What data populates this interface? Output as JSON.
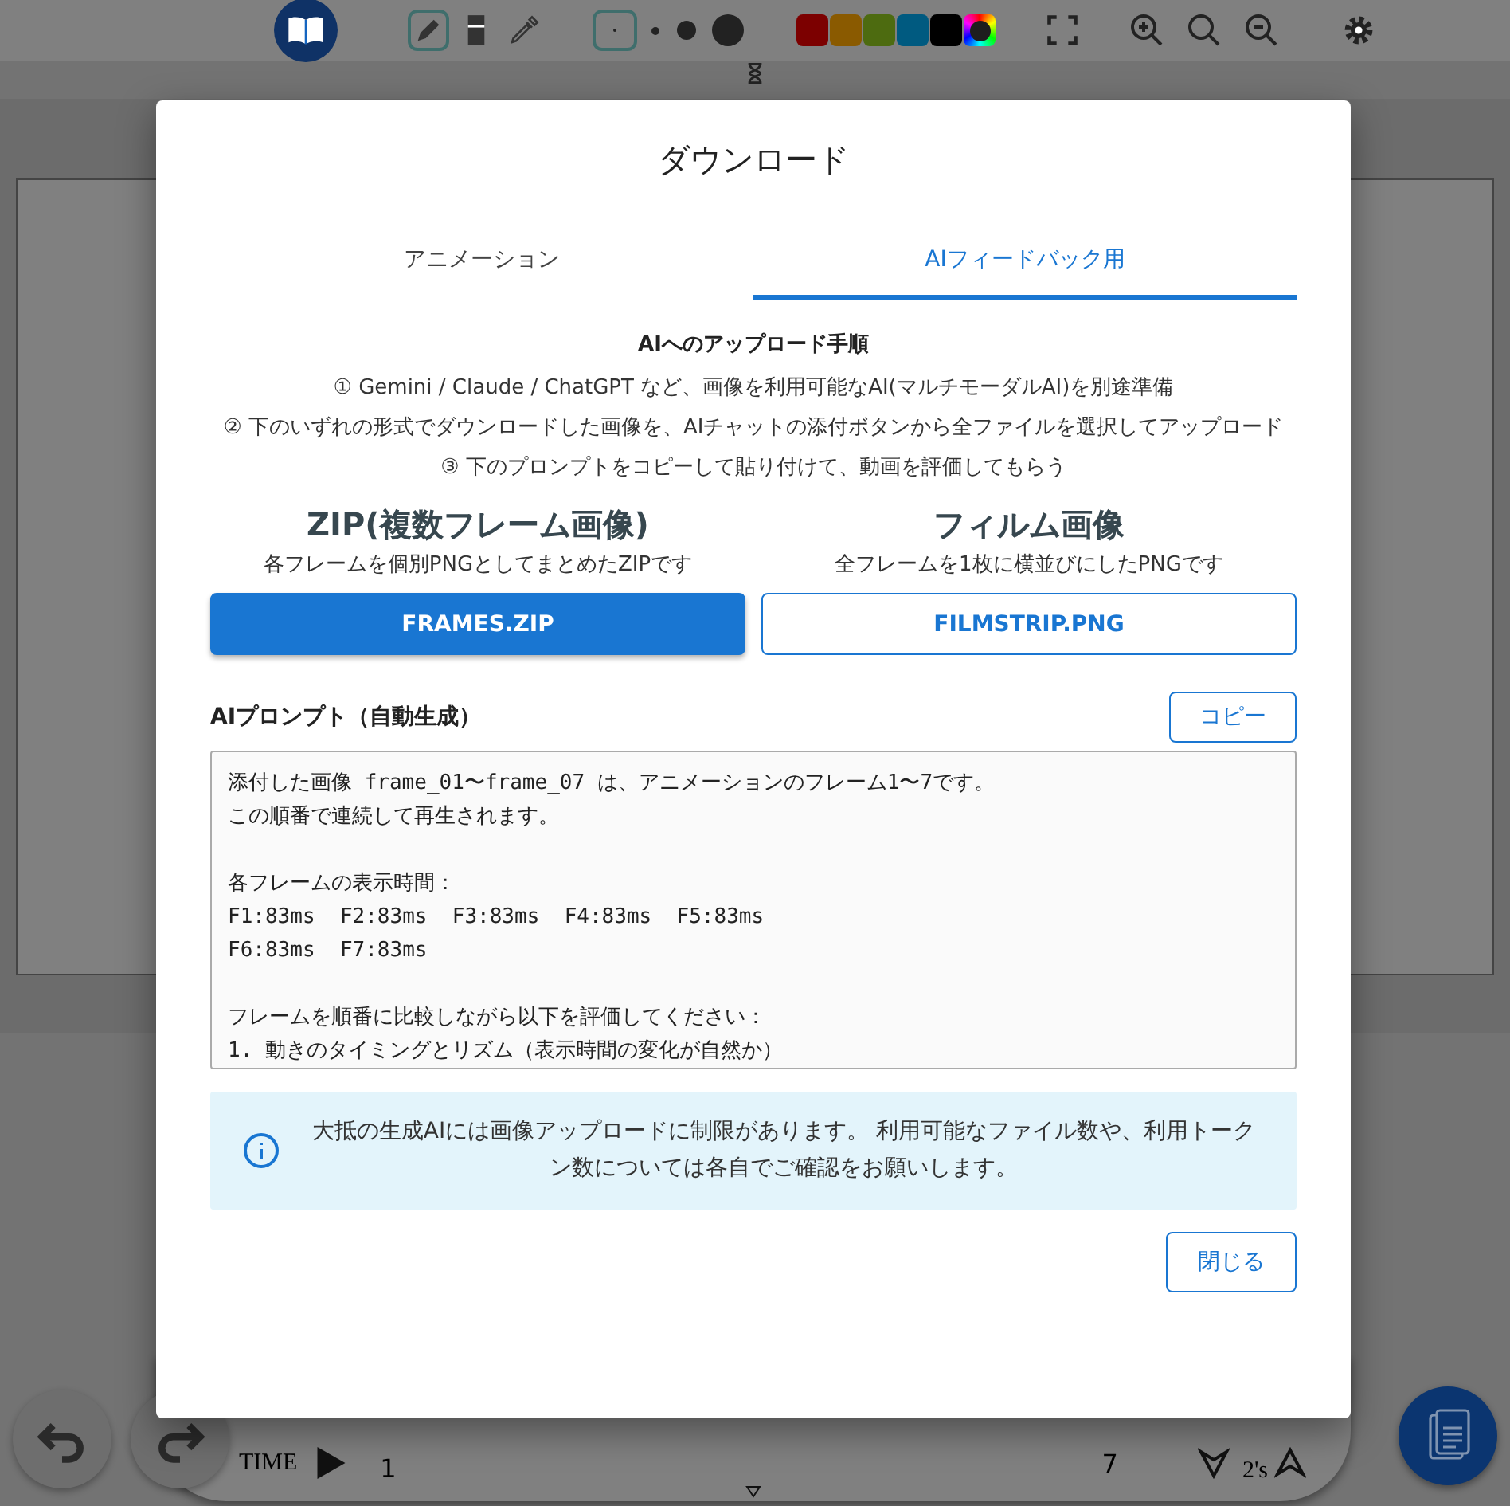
{
  "toolbar": {
    "tools": [
      {
        "kind": "pen",
        "selected": true
      },
      {
        "kind": "eraser",
        "selected": false
      },
      {
        "kind": "dropper",
        "selected": false
      }
    ],
    "brush_sizes": [
      {
        "selected": true
      },
      {
        "selected": false
      },
      {
        "selected": false
      },
      {
        "selected": false
      }
    ],
    "colors": [
      {
        "kind": "swatch",
        "color": "#7c0000"
      },
      {
        "kind": "swatch",
        "color": "#8a5a00"
      },
      {
        "kind": "swatch",
        "color": "#4d6b10"
      },
      {
        "kind": "swatch",
        "color": "#005a80"
      },
      {
        "kind": "swatch",
        "color": "#000000"
      },
      {
        "kind": "picker"
      }
    ]
  },
  "timeline": {
    "label": "TIME",
    "start": "1",
    "end": "7",
    "speed": "2's"
  },
  "dialog": {
    "title": "ダウンロード",
    "tabs": [
      {
        "label": "アニメーション",
        "selected": false
      },
      {
        "label": "AIフィードバック用",
        "selected": true
      }
    ],
    "instructions": {
      "heading": "AIへのアップロード手順",
      "steps": [
        "① Gemini / Claude / ChatGPT など、画像を利用可能なAI(マルチモーダルAI)を別途準備",
        "② 下のいずれの形式でダウンロードした画像を、AIチャットの添付ボタンから全ファイルを選択してアップロード",
        "③ 下のプロンプトをコピーして貼り付けて、動画を評価してもらう"
      ]
    },
    "downloads": [
      {
        "title": "ZIP(複数フレーム画像)",
        "description": "各フレームを個別PNGとしてまとめたZIPです",
        "button": "FRAMES.ZIP",
        "primary": true
      },
      {
        "title": "フィルム画像",
        "description": "全フレームを1枚に横並びにしたPNGです",
        "button": "FILMSTRIP.PNG",
        "primary": false
      }
    ],
    "prompt": {
      "label": "AIプロンプト（自動生成）",
      "copy_button": "コピー",
      "paragraphs": [
        [
          "添付した画像 frame_01〜frame_07 は、アニメーションのフレーム1〜7です。",
          "この順番で連続して再生されます。"
        ],
        [
          "各フレームの表示時間：",
          "F1:83ms  F2:83ms  F3:83ms  F4:83ms  F5:83ms",
          "F6:83ms  F7:83ms"
        ],
        [
          "フレームを順番に比較しながら以下を評価してください：",
          "1. 動きのタイミングとリズム（表示時間の変化が自然か）"
        ]
      ]
    },
    "notice": "大抵の生成AIには画像アップロードに制限があります。 利用可能なファイル数や、利用トークン数については各自でご確認をお願いします。",
    "close_button": "閉じる"
  }
}
